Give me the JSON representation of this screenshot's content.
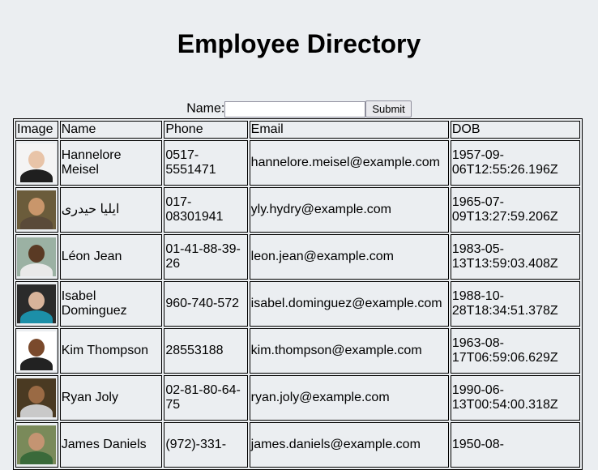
{
  "page_title": "Employee Directory",
  "search": {
    "label": "Name:",
    "value": "",
    "placeholder": "",
    "submit_label": "Submit"
  },
  "table": {
    "headers": [
      "Image",
      "Name",
      "Phone",
      "Email",
      "DOB"
    ],
    "rows": [
      {
        "name": "Hannelore Meisel",
        "phone": "0517-5551471",
        "email": "hannelore.meisel@example.com",
        "dob": "1957-09-06T12:55:26.196Z",
        "avatar_bg": "#f4f4f4",
        "skin": "#e8c4a8",
        "shirt": "#1f1f1f"
      },
      {
        "name": "ایلیا حیدری",
        "phone": "017-08301941",
        "email": "yly.hydry@example.com",
        "dob": "1965-07-09T13:27:59.206Z",
        "avatar_bg": "#6b5c3b",
        "skin": "#c9966b",
        "shirt": "#5a4a39"
      },
      {
        "name": "Léon Jean",
        "phone": "01-41-88-39-26",
        "email": "leon.jean@example.com",
        "dob": "1983-05-13T13:59:03.408Z",
        "avatar_bg": "#9bb1a3",
        "skin": "#5a3a24",
        "shirt": "#e9e9e9"
      },
      {
        "name": "Isabel Dominguez",
        "phone": "960-740-572",
        "email": "isabel.dominguez@example.com",
        "dob": "1988-10-28T18:34:51.378Z",
        "avatar_bg": "#2b2b2b",
        "skin": "#d8b39a",
        "shirt": "#1c8fa8"
      },
      {
        "name": "Kim Thompson",
        "phone": "28553188",
        "email": "kim.thompson@example.com",
        "dob": "1963-08-17T06:59:06.629Z",
        "avatar_bg": "#ffffff",
        "skin": "#7a4a2c",
        "shirt": "#222222"
      },
      {
        "name": "Ryan Joly",
        "phone": "02-81-80-64-75",
        "email": "ryan.joly@example.com",
        "dob": "1990-06-13T00:54:00.318Z",
        "avatar_bg": "#4a3a22",
        "skin": "#9a6a44",
        "shirt": "#c9c9c9"
      },
      {
        "name": "James Daniels",
        "phone": "(972)-331-",
        "email": "james.daniels@example.com",
        "dob": "1950-08-",
        "avatar_bg": "#7a8a5a",
        "skin": "#c49472",
        "shirt": "#3a6a3a"
      }
    ]
  }
}
